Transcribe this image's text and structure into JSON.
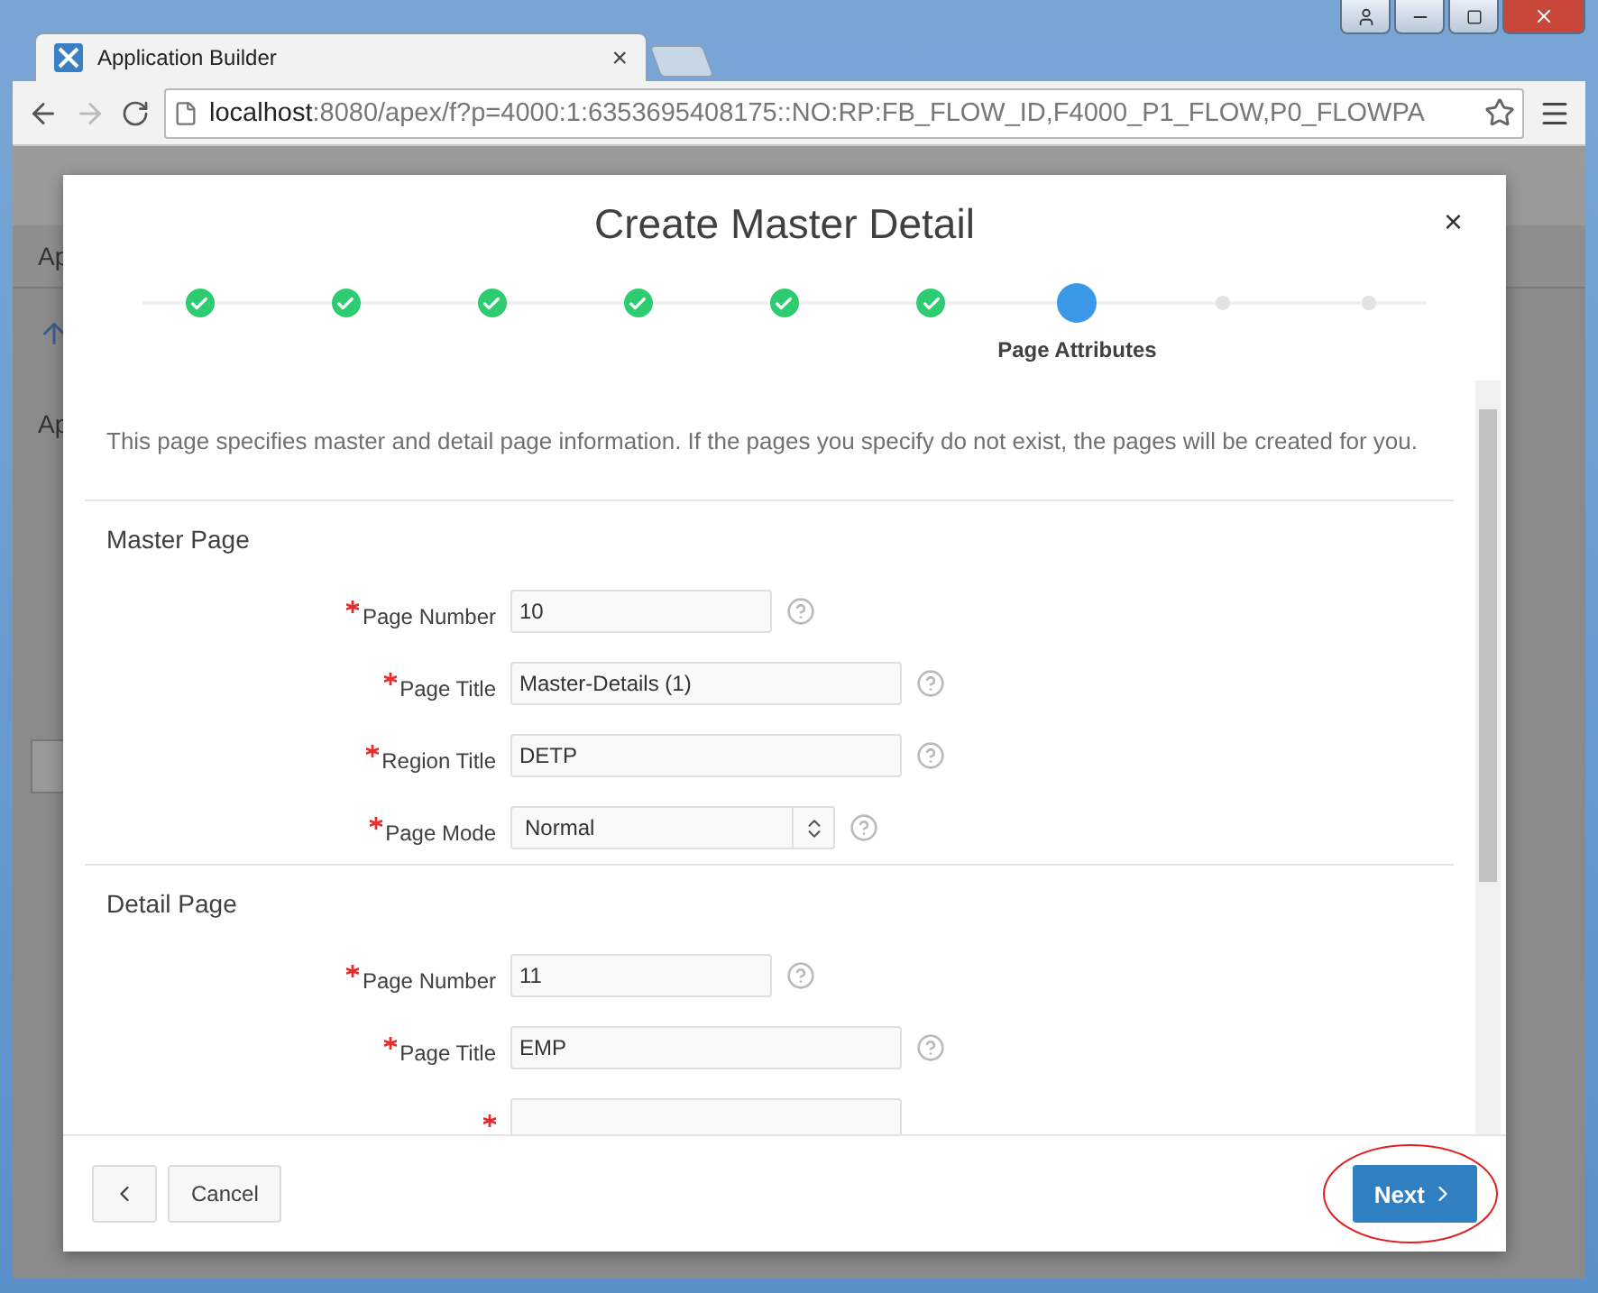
{
  "browser": {
    "tabs": [
      {
        "title": "Application Builder",
        "selected": true,
        "close": "×"
      }
    ],
    "address": {
      "host": "localhost",
      "path": ":8080/apex/f?p=4000:1:6353695408175::NO:RP:FB_FLOW_ID,F4000_P1_FLOW,P0_FLOWPA"
    }
  },
  "background": {
    "tab_label": "Ap",
    "heading": "Ap"
  },
  "dialog": {
    "title": "Create Master Detail",
    "close": "×",
    "steps": [
      {
        "done": true,
        "selected": false
      },
      {
        "done": true,
        "selected": false
      },
      {
        "done": true,
        "selected": false
      },
      {
        "done": true,
        "selected": false
      },
      {
        "done": true,
        "selected": false
      },
      {
        "done": true,
        "selected": false
      },
      {
        "done": false,
        "selected": true,
        "label": "Page Attributes"
      },
      {
        "done": false,
        "selected": false
      },
      {
        "done": false,
        "selected": false
      }
    ],
    "intro": "This page specifies master and detail page information. If the pages you specify do not exist, the pages will be created for you.",
    "sections": [
      {
        "title": "Master Page",
        "fields": [
          {
            "kind": "number",
            "label": "Page Number",
            "required": true,
            "value": "10"
          },
          {
            "kind": "text",
            "label": "Page Title",
            "required": true,
            "value": "Master-Details (1)"
          },
          {
            "kind": "text",
            "label": "Region Title",
            "required": true,
            "value": "DETP"
          },
          {
            "kind": "select",
            "label": "Page Mode",
            "required": true,
            "value": "Normal"
          }
        ]
      },
      {
        "title": "Detail Page",
        "fields": [
          {
            "kind": "number",
            "label": "Page Number",
            "required": true,
            "value": "11"
          },
          {
            "kind": "text",
            "label": "Page Title",
            "required": true,
            "value": "EMP"
          },
          {
            "kind": "text",
            "required": true
          }
        ]
      }
    ],
    "footer": {
      "cancel": "Cancel",
      "next": "Next",
      "next_highlighted": true
    }
  }
}
